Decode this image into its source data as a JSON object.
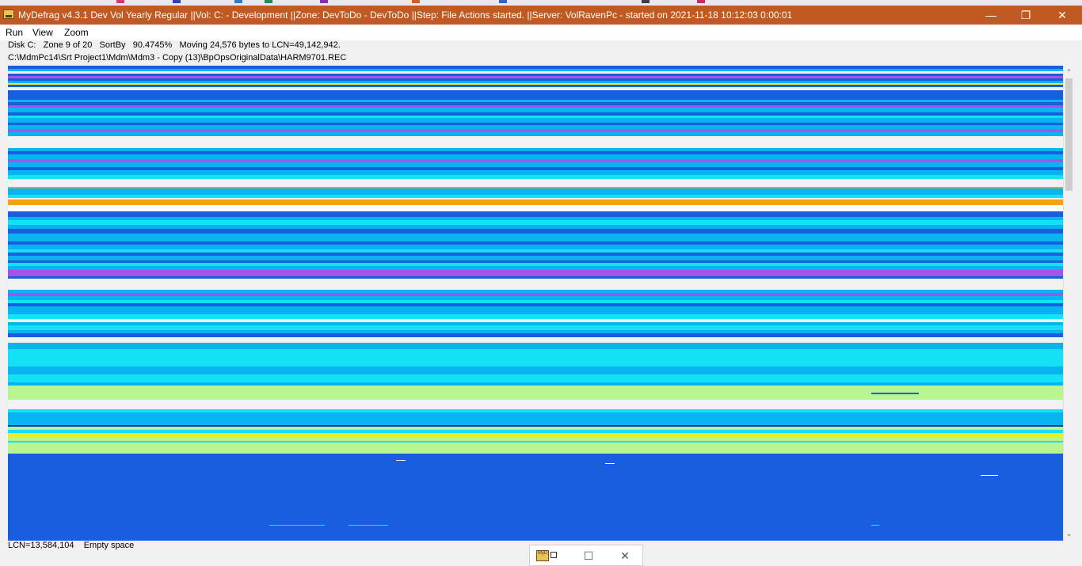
{
  "window": {
    "title": "MyDefrag v4.3.1   Dev Vol Yearly Regular ||Vol: C: - Development ||Zone: DevToDo - DevToDo ||Step: File Actions started. ||Server: VolRavenPc -  started on 2021-11-18 10:12:03 0:00:01",
    "titlebar_color": "#c05a20",
    "minimize_glyph": "—",
    "restore_glyph": "❐",
    "close_glyph": "✕"
  },
  "menu": {
    "items": [
      "Run",
      "View",
      "Zoom"
    ]
  },
  "status": {
    "line1": "Disk C:   Zone 9 of 20   SortBy   90.4745%   Moving 24,576 bytes to LCN=49,142,942.",
    "line2": "C:\\MdmPc14\\Srt Project1\\Mdm\\Mdm3 - Copy (13)\\BpOpsOriginalData\\HARM9701.REC",
    "bottom": "LCN=13,584,104    Empty space"
  },
  "taskbar_preview": {
    "icon_label": "MyD",
    "maximize_glyph": "☐",
    "close_glyph": "✕"
  },
  "scrollbar": {
    "up_glyph": "⌃",
    "down_glyph": "⌄"
  },
  "colors": {
    "empty": "#f2f2f2",
    "blue": "#1a5ee0",
    "sky": "#08b4f0",
    "cyan": "#14e2f4",
    "purple": "#a455e8",
    "orange": "#f4a214",
    "yellow": "#e8f020",
    "lime": "#b8f490",
    "navy": "#1234a0",
    "white": "#ffffff"
  }
}
